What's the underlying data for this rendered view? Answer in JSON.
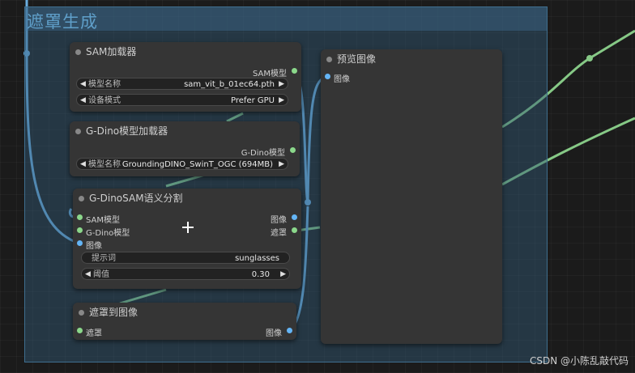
{
  "group": {
    "title": "遮罩生成"
  },
  "sam_loader": {
    "title": "SAM加载器",
    "output": "SAM模型",
    "model_label": "模型名称",
    "model_value": "sam_vit_b_01ec64.pth",
    "device_label": "设备模式",
    "device_value": "Prefer GPU"
  },
  "gdino_loader": {
    "title": "G-Dino模型加载器",
    "output": "G-Dino模型",
    "model_label": "模型名称",
    "model_value": "GroundingDINO_SwinT_OGC (694MB)"
  },
  "segment": {
    "title": "G-DinoSAM语义分割",
    "in_sam": "SAM模型",
    "in_gdino": "G-Dino模型",
    "in_image": "图像",
    "out_image": "图像",
    "out_mask": "遮罩",
    "prompt_label": "提示词",
    "prompt_value": "sunglasses",
    "threshold_label": "阈值",
    "threshold_value": "0.30"
  },
  "mask_to_image": {
    "title": "遮罩到图像",
    "input": "遮罩",
    "output": "图像"
  },
  "preview": {
    "title": "预览图像",
    "input": "图像"
  },
  "watermark": "CSDN @小陈乱敲代码",
  "colors": {
    "image_slot": "#64b5f6",
    "green_slot": "#8bd88b",
    "wire_blue": "#6aaee0",
    "wire_green": "#8ed08e"
  }
}
